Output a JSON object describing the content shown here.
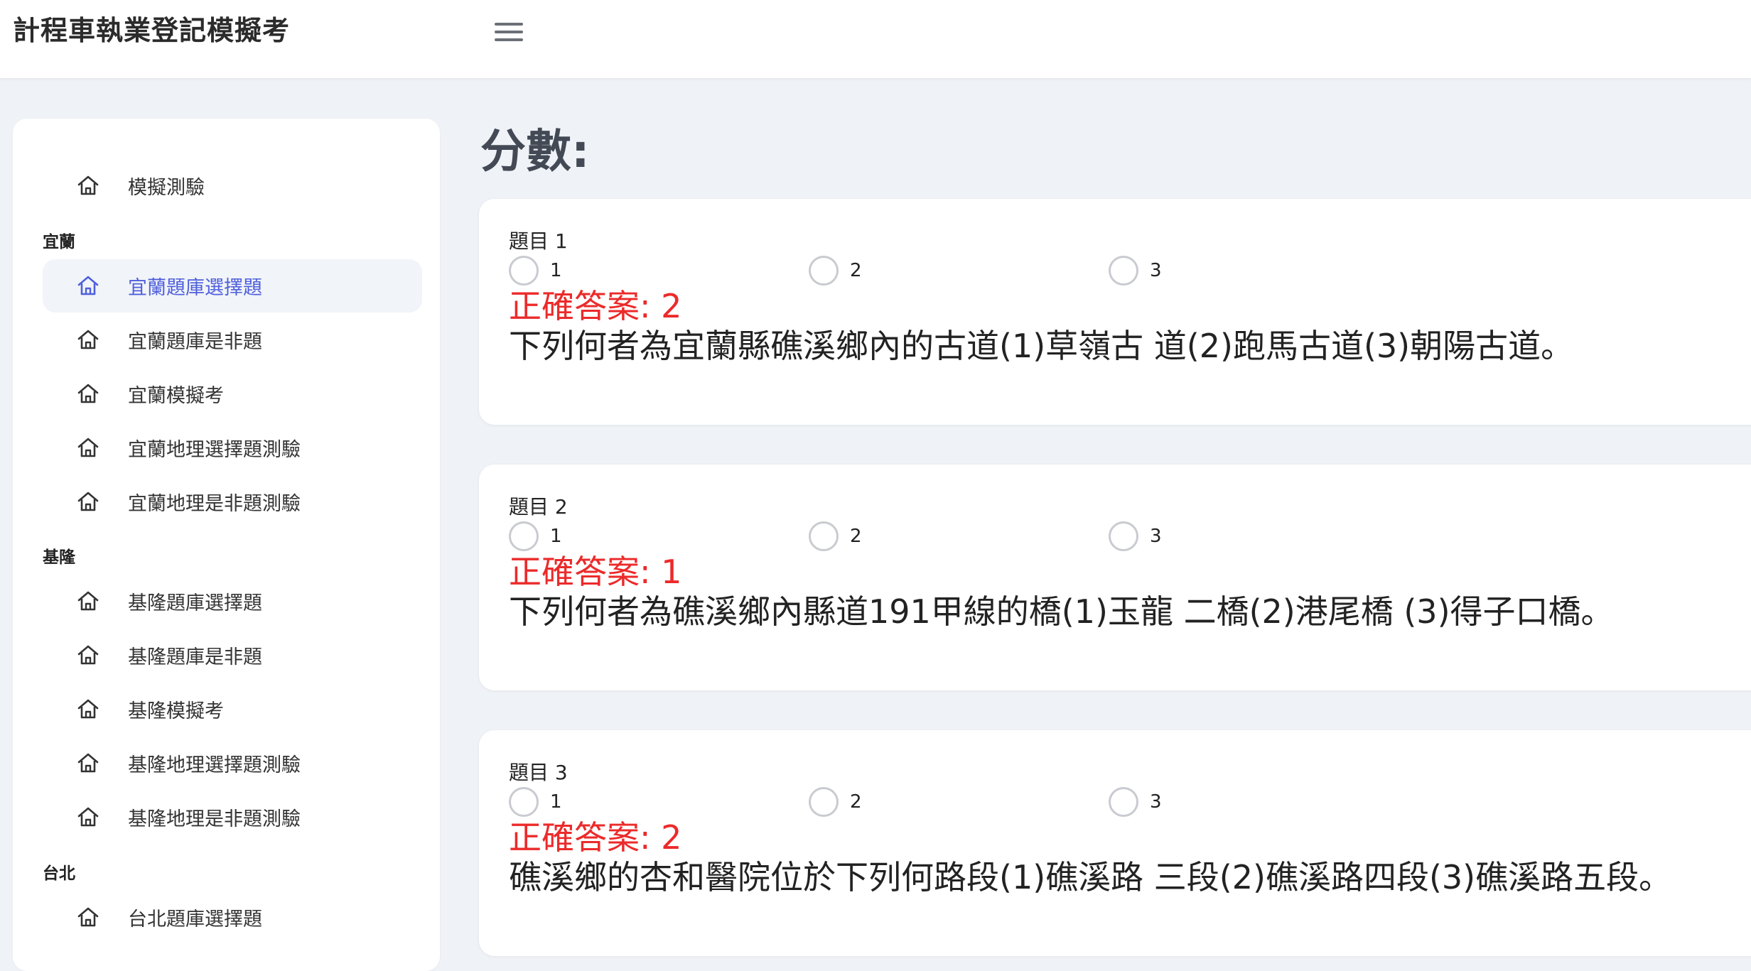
{
  "app": {
    "title": "計程車執業登記模擬考"
  },
  "sidebar": {
    "top_item": {
      "label": "模擬測驗",
      "icon": "home-icon"
    },
    "groups": [
      {
        "label": "宜蘭",
        "items": [
          {
            "label": "宜蘭題庫選擇題",
            "active": true,
            "icon": "home-icon"
          },
          {
            "label": "宜蘭題庫是非題",
            "icon": "home-icon"
          },
          {
            "label": "宜蘭模擬考",
            "icon": "home-icon"
          },
          {
            "label": "宜蘭地理選擇題測驗",
            "icon": "home-icon"
          },
          {
            "label": "宜蘭地理是非題測驗",
            "icon": "home-icon"
          }
        ]
      },
      {
        "label": "基隆",
        "items": [
          {
            "label": "基隆題庫選擇題",
            "icon": "home-icon"
          },
          {
            "label": "基隆題庫是非題",
            "icon": "home-icon"
          },
          {
            "label": "基隆模擬考",
            "icon": "home-icon"
          },
          {
            "label": "基隆地理選擇題測驗",
            "icon": "home-icon"
          },
          {
            "label": "基隆地理是非題測驗",
            "icon": "home-icon"
          }
        ]
      },
      {
        "label": "台北",
        "items": [
          {
            "label": "台北題庫選擇題",
            "icon": "home-icon"
          }
        ]
      }
    ]
  },
  "main": {
    "score_label": "分數:",
    "questions": [
      {
        "title": "題目 1",
        "options": [
          "1",
          "2",
          "3"
        ],
        "answer": "正確答案: 2",
        "text": "下列何者為宜蘭縣礁溪鄉內的古道(1)草嶺古 道(2)跑馬古道(3)朝陽古道。"
      },
      {
        "title": "題目 2",
        "options": [
          "1",
          "2",
          "3"
        ],
        "answer": "正確答案: 1",
        "text": "下列何者為礁溪鄉內縣道191甲線的橋(1)玉龍 二橋(2)港尾橋 (3)得子口橋。"
      },
      {
        "title": "題目 3",
        "options": [
          "1",
          "2",
          "3"
        ],
        "answer": "正確答案: 2",
        "text": "礁溪鄉的杏和醫院位於下列何路段(1)礁溪路 三段(2)礁溪路四段(3)礁溪路五段。"
      }
    ]
  },
  "colors": {
    "accent": "#4f5fdc",
    "answer_red": "#ec2a2a",
    "background": "#eff2f6"
  }
}
